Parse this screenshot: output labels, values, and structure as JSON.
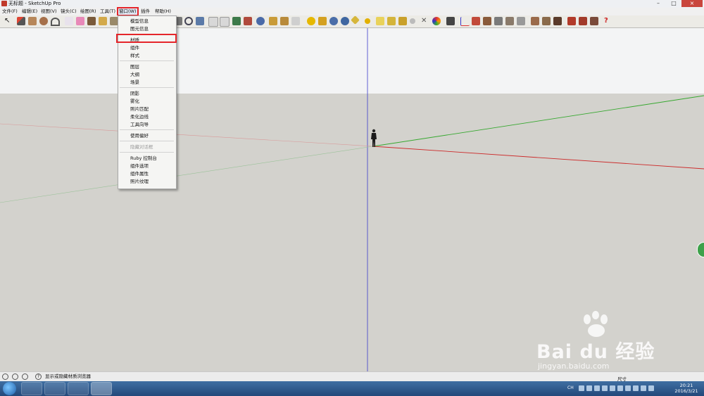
{
  "window": {
    "title": "无标题 - SketchUp Pro"
  },
  "menubar": {
    "items": [
      "文件(F)",
      "编辑(E)",
      "视图(V)",
      "镜头(C)",
      "绘图(R)",
      "工具(T)",
      "窗口(W)",
      "插件",
      "帮助(H)"
    ],
    "active": "窗口(W)"
  },
  "dropdown": {
    "items": [
      "模型信息",
      "图元信息",
      "材质",
      "组件",
      "样式",
      "图层",
      "大纲",
      "场景",
      "阴影",
      "雾化",
      "照片匹配",
      "柔化边线",
      "工具向导",
      "使用偏好",
      "隐藏对话框",
      "Ruby 控制台",
      "组件选项",
      "组件属性",
      "照片纹理"
    ],
    "highlighted": "材质",
    "disabled": "隐藏对话框"
  },
  "statusbar": {
    "hint": "显示或隐藏材质浏览器",
    "measurement_label": "尺寸"
  },
  "taskbar": {
    "time": "20:21",
    "date": "2016/3/21",
    "ime": "CH"
  },
  "watermark": {
    "brand": "Bai du 经验",
    "url": "jingyan.baidu.com"
  },
  "colors": {
    "red_axis": "#cc2b2b",
    "green_axis": "#36a82f",
    "blue_axis": "#3a3acb",
    "highlight": "#e5252a"
  }
}
